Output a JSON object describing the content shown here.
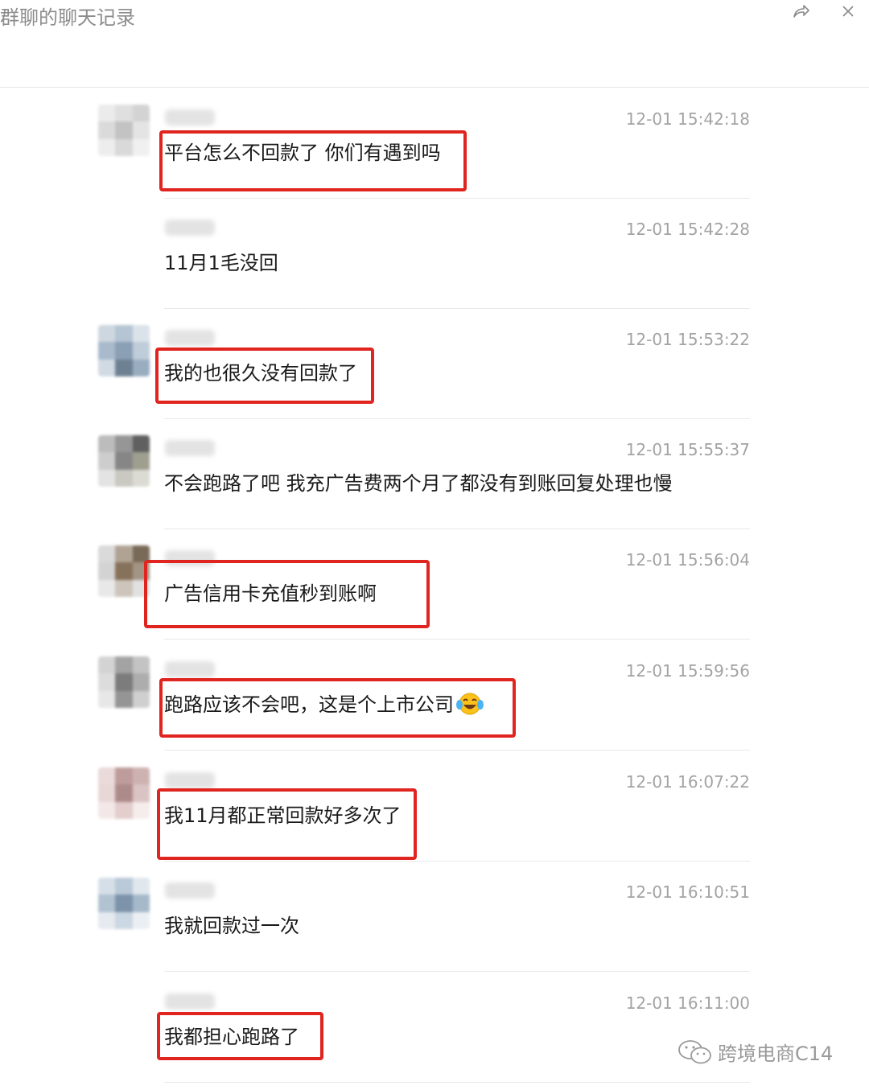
{
  "window": {
    "title": "群聊的聊天记录",
    "share_icon": "share-forward-icon",
    "close_icon": "close-icon"
  },
  "messages": [
    {
      "time": "12-01 15:42:18",
      "text": "平台怎么不回款了 你们有遇到吗",
      "highlighted": true
    },
    {
      "time": "12-01 15:42:28",
      "text": "11月1毛没回",
      "highlighted": false
    },
    {
      "time": "12-01 15:53:22",
      "text": "我的也很久没有回款了",
      "highlighted": true
    },
    {
      "time": "12-01 15:55:37",
      "text": "不会跑路了吧 我充广告费两个月了都没有到账回复处理也慢",
      "highlighted": false
    },
    {
      "time": "12-01 15:56:04",
      "text": "广告信用卡充值秒到账啊",
      "highlighted": true
    },
    {
      "time": "12-01 15:59:56",
      "text": "跑路应该不会吧，这是个上市公司",
      "emoji": "tears-of-joy-emoji",
      "highlighted": true
    },
    {
      "time": "12-01 16:07:22",
      "text": "我11月都正常回款好多次了",
      "highlighted": true
    },
    {
      "time": "12-01 16:10:51",
      "text": "我就回款过一次",
      "highlighted": false
    },
    {
      "time": "12-01 16:11:00",
      "text": "我都担心跑路了",
      "highlighted": true
    }
  ],
  "watermark": {
    "icon": "wechat-icon",
    "text": "跨境电商C14"
  },
  "colors": {
    "highlight": "#e0241f",
    "timestamp": "#a3a3a3",
    "title": "#8c8c8c"
  }
}
